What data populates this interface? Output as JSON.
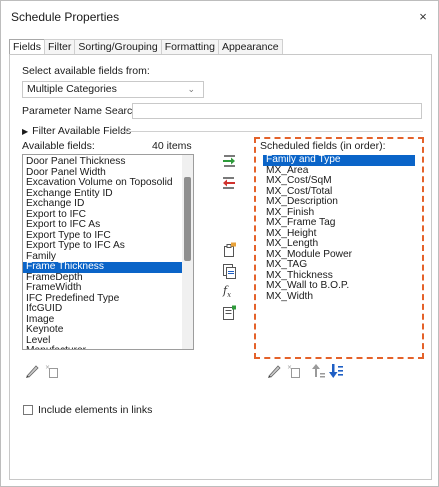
{
  "window": {
    "title": "Schedule Properties",
    "close_glyph": "×"
  },
  "tabs": [
    {
      "label": "Fields",
      "active": true
    },
    {
      "label": "Filter"
    },
    {
      "label": "Sorting/Grouping"
    },
    {
      "label": "Formatting"
    },
    {
      "label": "Appearance"
    }
  ],
  "fields": {
    "select_label": "Select available fields from:",
    "category_value": "Multiple Categories",
    "param_search_label": "Parameter Name Search:",
    "param_search_value": "",
    "filter_toggle_label": "Filter Available Fields",
    "available_label": "Available fields:",
    "item_count": "40 items",
    "scheduled_label": "Scheduled fields (in order):",
    "available_fields": [
      "Door Panel Thickness",
      "Door Panel Width",
      "Excavation Volume on Toposolid",
      "Exchange Entity ID",
      "Exchange ID",
      "Export to IFC",
      "Export to IFC As",
      "Export Type to IFC",
      "Export Type to IFC As",
      "Family",
      "Frame Thickness",
      "FrameDepth",
      "FrameWidth",
      "IFC Predefined Type",
      "IfcGUID",
      "Image",
      "Keynote",
      "Level",
      "Manufacturer"
    ],
    "available_selected_index": 10,
    "scheduled_fields": [
      "Family and Type",
      "MX_Area",
      "MX_Cost/SqM",
      "MX_Cost/Total",
      "MX_Description",
      "MX_Finish",
      "MX_Frame Tag",
      "MX_Height",
      "MX_Length",
      "MX_Module Power",
      "MX_TAG",
      "MX_Thickness",
      "MX_Wall to B.O.P.",
      "MX_Width"
    ],
    "scheduled_selected_index": 0,
    "include_links_label": "Include elements in links",
    "include_links_checked": false
  },
  "colors": {
    "selection": "#0a64c8",
    "dashed_highlight": "#e4622a",
    "add_arrow": "#2e9b3a",
    "remove_arrow": "#d0312d",
    "move_arrow": "#1f5fc4"
  },
  "icons": {
    "add": "add-field-icon",
    "remove": "remove-field-icon",
    "new_parameter": "new-parameter-icon",
    "combine": "combine-parameters-icon",
    "calculated": "calculated-value-icon",
    "edit_parameter": "edit-parameter-icon",
    "edit": "pencil-icon",
    "delete": "delete-parameter-icon",
    "move_up": "move-up-icon",
    "move_down": "move-down-icon"
  }
}
